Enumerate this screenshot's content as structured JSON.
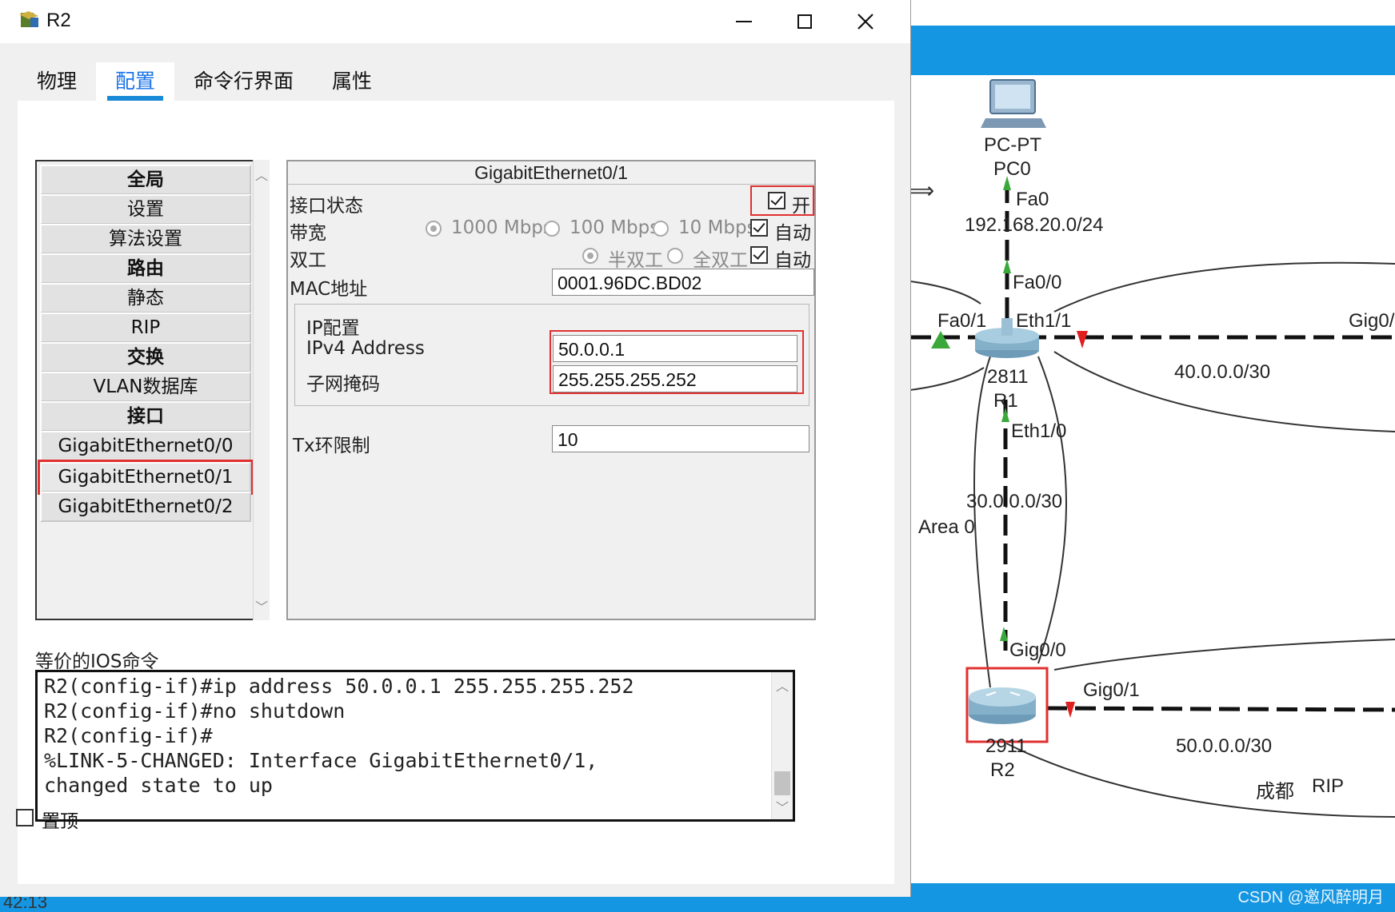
{
  "window": {
    "title": "R2",
    "icons": {
      "app": "router-config-icon",
      "minimize": "minimize-icon",
      "maximize": "maximize-icon",
      "close": "close-icon"
    }
  },
  "tabs": [
    {
      "label": "物理",
      "active": false
    },
    {
      "label": "配置",
      "active": true
    },
    {
      "label": "命令行界面",
      "active": false
    },
    {
      "label": "属性",
      "active": false
    }
  ],
  "nav": {
    "items": [
      {
        "label": "全局",
        "type": "header"
      },
      {
        "label": "设置",
        "type": "item"
      },
      {
        "label": "算法设置",
        "type": "item"
      },
      {
        "label": "路由",
        "type": "header"
      },
      {
        "label": "静态",
        "type": "item"
      },
      {
        "label": "RIP",
        "type": "item"
      },
      {
        "label": "交换",
        "type": "header"
      },
      {
        "label": "VLAN数据库",
        "type": "item"
      },
      {
        "label": "接口",
        "type": "header"
      },
      {
        "label": "GigabitEthernet0/0",
        "type": "item"
      },
      {
        "label": "GigabitEthernet0/1",
        "type": "item",
        "selected": true
      },
      {
        "label": "GigabitEthernet0/2",
        "type": "item"
      }
    ]
  },
  "config": {
    "title": "GigabitEthernet0/1",
    "port_status": {
      "label": "接口状态",
      "on_label": "开",
      "checked": true
    },
    "bandwidth": {
      "label": "带宽",
      "options": [
        "1000 Mbps",
        "100 Mbps",
        "10 Mbps"
      ],
      "selected": "1000 Mbps",
      "auto_label": "自动",
      "auto": true
    },
    "duplex": {
      "label": "双工",
      "options": [
        "半双工",
        "全双工"
      ],
      "selected": "半双工",
      "auto_label": "自动",
      "auto": true
    },
    "mac": {
      "label": "MAC地址",
      "value": "0001.96DC.BD02"
    },
    "ip": {
      "group_label": "IP配置",
      "ipv4_label": "IPv4 Address",
      "ipv4_value": "50.0.0.1",
      "mask_label": "子网掩码",
      "mask_value": "255.255.255.252"
    },
    "tx_ring": {
      "label": "Tx环限制",
      "value": "10"
    }
  },
  "ios": {
    "label": "等价的IOS命令",
    "text": "R2(config-if)#ip address 50.0.0.1 255.255.255.252\nR2(config-if)#no shutdown\nR2(config-if)#\n%LINK-5-CHANGED: Interface GigabitEthernet0/1,\nchanged state to up"
  },
  "pin": {
    "label": "置顶",
    "checked": false
  },
  "taskbar": {
    "time": "42:13"
  },
  "topology": {
    "labels": {
      "pc_model": "PC-PT",
      "pc_name": "PC0",
      "pc_port": "Fa0",
      "net_pc": "192.168.20.0/24",
      "r1_fa00": "Fa0/0",
      "r1_fa01": "Fa0/1",
      "r1_eth11": "Eth1/1",
      "gig0_right": "Gig0/",
      "net_40": "40.0.0.0/30",
      "r1_model": "2811",
      "r1_name": "R1",
      "r1_eth10": "Eth1/0",
      "net_30": "30.0.0.0/30",
      "area": "Area 0",
      "r2_gig00": "Gig0/0",
      "r2_gig01": "Gig0/1",
      "net_50": "50.0.0.0/30",
      "r2_model": "2911",
      "r2_name": "R2",
      "city": "成都",
      "proto": "RIP"
    },
    "watermark": "CSDN @邀风醉明月",
    "icons": {
      "pc": "pc-icon",
      "router1": "router-icon",
      "router2": "router-icon",
      "resize": "resize-arrow-icon"
    }
  }
}
